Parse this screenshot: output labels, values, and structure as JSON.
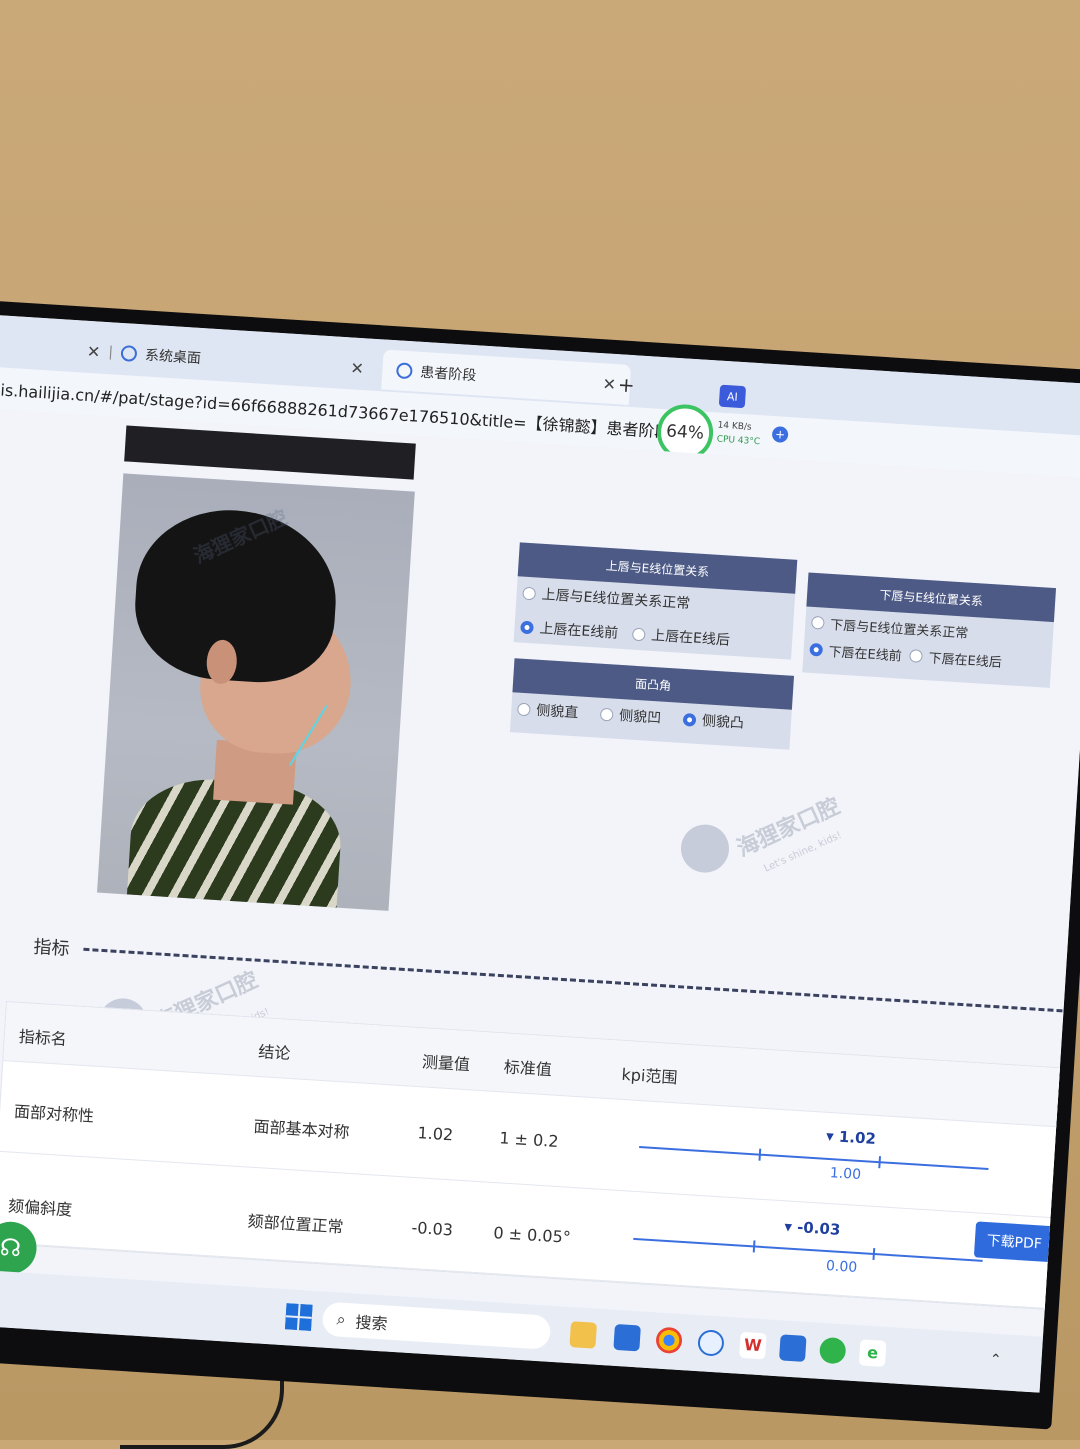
{
  "browser": {
    "tab1_label": "系统桌面",
    "tab2_label": "患者阶段",
    "url": "his.hailijia.cn/#/pat/stage?id=66f66888261d73667e176510&title=【徐锦懿】患者阶段",
    "ai_label": "AI",
    "perf_percent": "64%",
    "net_speed": "14 KB/s",
    "cpu": "CPU 43°C"
  },
  "watermark": {
    "text": "海狸家口腔",
    "slogan": "Let's shine, kids!"
  },
  "panels": {
    "upper_lip": {
      "title": "上唇与E线位置关系",
      "options": [
        "上唇与E线位置关系正常",
        "上唇在E线前",
        "上唇在E线后"
      ],
      "selected": "上唇在E线前"
    },
    "lower_lip": {
      "title": "下唇与E线位置关系",
      "options": [
        "下唇与E线位置关系正常",
        "下唇在E线前",
        "下唇在E线后"
      ],
      "selected": "下唇在E线前"
    },
    "profile": {
      "title": "面凸角",
      "options": [
        "侧貌直",
        "侧貌凹",
        "侧貌凸"
      ],
      "selected": "侧貌凸"
    }
  },
  "indicators": {
    "section_label": "指标",
    "headers": [
      "指标名",
      "结论",
      "测量值",
      "标准值",
      "kpi范围"
    ],
    "rows": [
      {
        "name": "面部对称性",
        "conclusion": "面部基本对称",
        "measured": "1.02",
        "standard": "1 ± 0.2",
        "kpi_value": "1.02",
        "kpi_std": "1.00"
      },
      {
        "name": "颏偏斜度",
        "conclusion": "颏部位置正常",
        "measured": "-0.03",
        "standard": "0 ± 0.05°",
        "kpi_value": "-0.03",
        "kpi_std": "0.00"
      }
    ],
    "download_label": "下载PDF"
  },
  "taskbar": {
    "search_label": "搜索"
  }
}
